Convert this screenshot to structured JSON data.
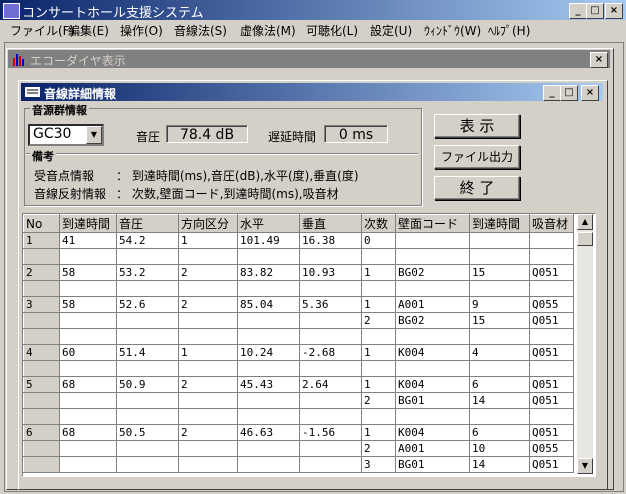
{
  "main_window": {
    "title": "コンサートホール支援システム",
    "caption_buttons": {
      "minimize": "_",
      "maximize": "□",
      "close": "×"
    }
  },
  "menubar": {
    "items": [
      "ファイル(F)",
      "編集(E)",
      "操作(O)",
      "音線法(S)",
      "虚像法(M)",
      "可聴化(L)",
      "設定(U)",
      "ｳｨﾝﾄﾞｳ(W)",
      "ﾍﾙﾌﾟ(H)"
    ]
  },
  "echo_window": {
    "title": "エコーダイヤ表示",
    "close": "×"
  },
  "dialog": {
    "title": "音線詳細情報",
    "caption_buttons": {
      "minimize": "_",
      "maximize": "□",
      "close": "×"
    },
    "group_label": "音源群情報",
    "combo_value": "GC30",
    "sound_pressure_label": "音圧",
    "sound_pressure_value": "78.4 dB",
    "delay_label": "遅延時間",
    "delay_value": "0 ms",
    "notes_label": "備考",
    "note1_label": "受音点情報",
    "note1_text": "： 到達時間(ms),音圧(dB),水平(度),垂直(度)",
    "note2_label": "音線反射情報",
    "note2_text": "： 次数,壁面コード,到達時間(ms),吸音材",
    "buttons": {
      "display": "表 示",
      "file_output": "ファイル出力",
      "close": "終 了"
    }
  },
  "grid": {
    "headers": [
      "No",
      "到達時間",
      "音圧",
      "方向区分",
      "水平",
      "垂直",
      "次数",
      "壁面コード",
      "到達時間",
      "吸音材"
    ],
    "rows": [
      [
        "1",
        "41",
        "54.2",
        "1",
        "101.49",
        "16.38",
        "0",
        "",
        "",
        ""
      ],
      [
        "",
        "",
        "",
        "",
        "",
        "",
        "",
        "",
        "",
        ""
      ],
      [
        "2",
        "58",
        "53.2",
        "2",
        "83.82",
        "10.93",
        "1",
        "BG02",
        "15",
        "Q051"
      ],
      [
        "",
        "",
        "",
        "",
        "",
        "",
        "",
        "",
        "",
        ""
      ],
      [
        "3",
        "58",
        "52.6",
        "2",
        "85.04",
        "5.36",
        "1",
        "A001",
        "9",
        "Q055"
      ],
      [
        "",
        "",
        "",
        "",
        "",
        "",
        "2",
        "BG02",
        "15",
        "Q051"
      ],
      [
        "",
        "",
        "",
        "",
        "",
        "",
        "",
        "",
        "",
        ""
      ],
      [
        "4",
        "60",
        "51.4",
        "1",
        "10.24",
        "-2.68",
        "1",
        "K004",
        "4",
        "Q051"
      ],
      [
        "",
        "",
        "",
        "",
        "",
        "",
        "",
        "",
        "",
        ""
      ],
      [
        "5",
        "68",
        "50.9",
        "2",
        "45.43",
        "2.64",
        "1",
        "K004",
        "6",
        "Q051"
      ],
      [
        "",
        "",
        "",
        "",
        "",
        "",
        "2",
        "BG01",
        "14",
        "Q051"
      ],
      [
        "",
        "",
        "",
        "",
        "",
        "",
        "",
        "",
        "",
        ""
      ],
      [
        "6",
        "68",
        "50.5",
        "2",
        "46.63",
        "-1.56",
        "1",
        "K004",
        "6",
        "Q051"
      ],
      [
        "",
        "",
        "",
        "",
        "",
        "",
        "2",
        "A001",
        "10",
        "Q055"
      ],
      [
        "",
        "",
        "",
        "",
        "",
        "",
        "3",
        "BG01",
        "14",
        "Q051"
      ]
    ]
  }
}
